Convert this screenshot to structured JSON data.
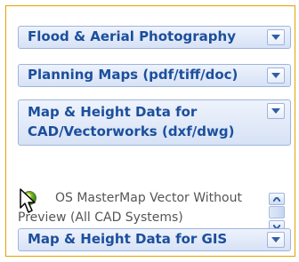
{
  "panels": [
    {
      "title": "Flood & Aerial Photography"
    },
    {
      "title": "Planning Maps (pdf/tiff/doc)"
    },
    {
      "title": "Map & Height Data for CAD/Vectorworks (dxf/dwg)"
    },
    {
      "title": "Map & Height Data for GIS"
    }
  ],
  "list": {
    "item_line1": "OS MasterMap Vector Without",
    "item_line2": "Preview (All CAD Systems)"
  },
  "icons": {
    "panel_toggle": "chevron-down-icon",
    "scroll_up": "chevron-up-icon",
    "scroll_down": "chevron-down-icon",
    "cursor": "mouse-pointer-icon"
  },
  "colors": {
    "panel_title": "#1c4f9c",
    "frame_accent": "#f2b000",
    "panel_border": "#9fb4dc"
  }
}
